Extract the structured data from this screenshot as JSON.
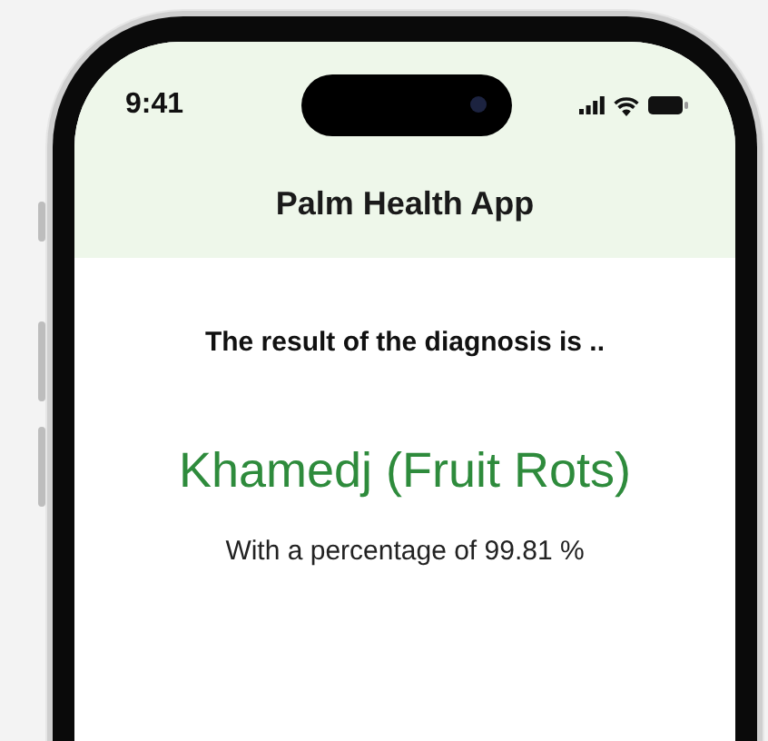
{
  "status_bar": {
    "time": "9:41"
  },
  "header": {
    "title": "Palm Health App"
  },
  "result": {
    "intro": "The result of the diagnosis is ..",
    "diagnosis": "Khamedj (Fruit Rots)",
    "percentage": "With a percentage of 99.81 %"
  }
}
